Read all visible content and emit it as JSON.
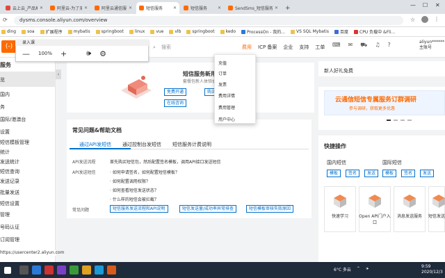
{
  "browser": {
    "tabs": [
      {
        "title": "云上云_产品地址",
        "color": "#e24a3b"
      },
      {
        "title": "阿里云-为了无数客户联",
        "color": "#ff6a00"
      },
      {
        "title": "阿里云通信服务控",
        "color": "#ff6a00"
      },
      {
        "title": "短信服务",
        "color": "#ff6a00",
        "active": true
      },
      {
        "title": "短信服务",
        "color": "#ff6a00"
      },
      {
        "title": "SendSms_短信服务_API",
        "color": "#ff6a00"
      }
    ],
    "url": "dysms.console.aliyun.com/overview",
    "bookmarks": [
      "ding",
      "soa",
      "扩展程序",
      "mybatis",
      "springboot",
      "linux",
      "vue",
      "vlb",
      "springboot",
      "kedo",
      "ProcessOn - 我的...",
      "VS SQL Mybatis",
      "百度",
      "CPU 负载中 &Fli..."
    ]
  },
  "player": {
    "title": "录入课",
    "zoom": "100%",
    "minus": "—",
    "plus": "+"
  },
  "console": {
    "logo": "(-)",
    "search_placeholder": "搜索",
    "nav": [
      {
        "label": "费用",
        "active": true
      },
      {
        "label": "ICP 备案"
      },
      {
        "label": "企业"
      },
      {
        "label": "支持"
      },
      {
        "label": "工单"
      }
    ],
    "user_line1": "aliyun******",
    "user_line2": "主账号"
  },
  "dropdown": [
    "充值",
    "订单",
    "发票",
    "费用详情",
    "费用管理",
    "用户中心"
  ],
  "sidebar": {
    "header": "服务",
    "items": [
      "览",
      "国内",
      "务",
      "国际/港澳台",
      "设置",
      "短信模板管理",
      "统计",
      "发送统计",
      "短信查询",
      "发送记录",
      "批量发送",
      "短信设置",
      "管理",
      "号码认证",
      "订阅管理"
    ]
  },
  "banner": {
    "title": "短信服务新用户0元免费试用",
    "subtitle": "套餐包新人体验价仅需0元，...",
    "buttons": [
      "免费开通",
      "购买套餐包",
      "在线咨询"
    ]
  },
  "faq": {
    "title": "常见问题&帮助文档",
    "tabs": [
      "通过API发短信",
      "通过控制台发短信",
      "短信服务计费说明"
    ],
    "rows": [
      {
        "label": "API发送流程",
        "text": "首先购买短信包，然后配置签名模板，调用API接口发送短信"
      },
      {
        "label": "API发送短信",
        "text": "· 如何申请签名，如何配置短信模板？"
      },
      {
        "label": "",
        "text": "· 如何配置调用权限？"
      },
      {
        "label": "",
        "text": "· 如何查看短信发送状态？"
      },
      {
        "label": "",
        "text": "· 什么样的短信会被拦截？"
      }
    ],
    "related_label": "常见问题",
    "related_tags": [
      "短信服务发送流程和API说明",
      "短信发送量/成功率异常排查",
      "短信模板审核失败原因"
    ]
  },
  "right": {
    "top_text": "新人好礼免费",
    "ad_title": "云通信短信专属服务订群调研",
    "ad_sub": "参与调研，获取更多优惠",
    "quick_title": "快捷操作",
    "sec1": "国内短信",
    "sec2": "国际短信",
    "buttons1": [
      "模板",
      "签名",
      "发送"
    ],
    "buttons2": [
      "模板",
      "签名",
      "发送"
    ],
    "cards": [
      "快速学习",
      "Open API门户入口",
      "消息发送服务",
      "短信发送"
    ]
  },
  "status_url": "https://usercenter2.aliyun.com",
  "taskbar": {
    "weather": "6°C 多云",
    "clock_time": "9:59",
    "clock_date": "2020/12/3"
  }
}
